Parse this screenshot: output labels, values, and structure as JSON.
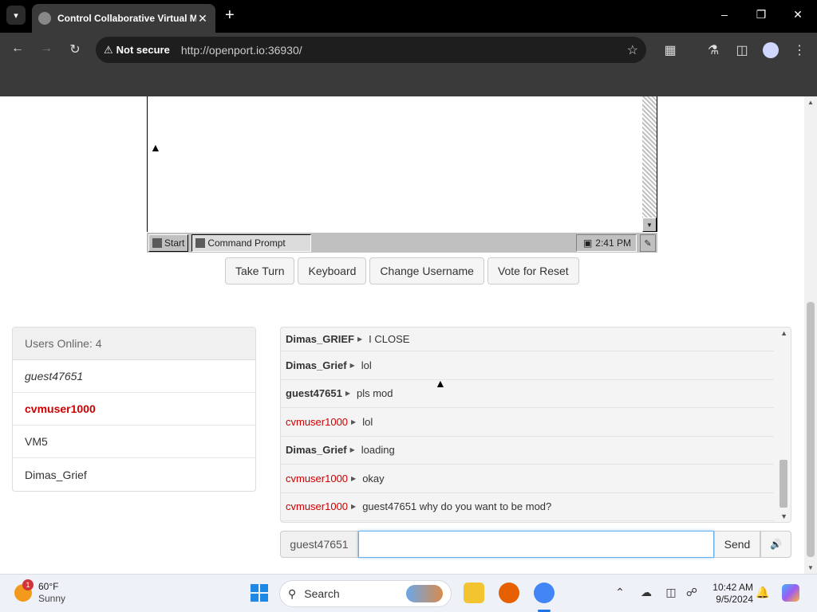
{
  "browser": {
    "tab_title": "Control Collaborative Virtual M",
    "security_label": "Not secure",
    "url": "http://openport.io:36930/"
  },
  "vm": {
    "start_label": "Start",
    "task_label": "Command Prompt",
    "clock": "2:41 PM"
  },
  "controls": {
    "take_turn": "Take Turn",
    "keyboard": "Keyboard",
    "change_username": "Change Username",
    "vote_reset": "Vote for Reset"
  },
  "users": {
    "header": "Users Online: 4",
    "list": [
      {
        "name": "guest47651",
        "role": "guest"
      },
      {
        "name": "cvmuser1000",
        "role": "admin"
      },
      {
        "name": "VM5",
        "role": "normal"
      },
      {
        "name": "Dimas_Grief",
        "role": "normal"
      }
    ]
  },
  "chat": {
    "messages": [
      {
        "user": "Dimas_GRIEF",
        "text": "I CLOSE",
        "admin": false
      },
      {
        "user": "Dimas_Grief",
        "text": "lol",
        "admin": false
      },
      {
        "user": "guest47651",
        "text": "pls mod",
        "admin": false
      },
      {
        "user": "cvmuser1000",
        "text": "lol",
        "admin": true
      },
      {
        "user": "Dimas_Grief",
        "text": "loading",
        "admin": false
      },
      {
        "user": "cvmuser1000",
        "text": "okay",
        "admin": true
      },
      {
        "user": "cvmuser1000",
        "text": "guest47651 why do you want to be mod?",
        "admin": true
      }
    ],
    "username": "guest47651",
    "input_value": "",
    "send_label": "Send"
  },
  "taskbar": {
    "weather_temp": "60°F",
    "weather_desc": "Sunny",
    "weather_badge": "1",
    "search_label": "Search",
    "time": "10:42 AM",
    "date": "9/5/2024"
  },
  "colors": {
    "admin": "#cc0000",
    "accent": "#1e73e8"
  }
}
